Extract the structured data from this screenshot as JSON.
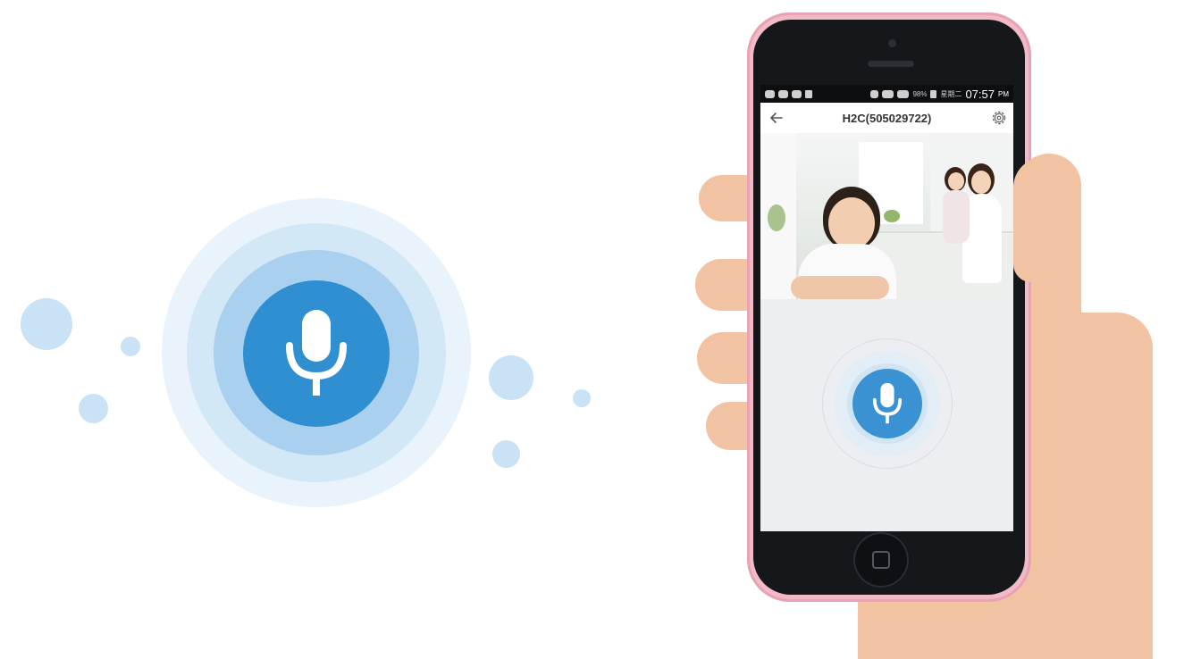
{
  "status_bar": {
    "battery_text": "98%",
    "day_text": "星期二",
    "time": "07:57",
    "ampm": "PM"
  },
  "app_bar": {
    "title": "H2C(505029722)"
  },
  "icons": {
    "back": "arrow-left-icon",
    "settings": "gear-icon",
    "mic": "microphone-icon",
    "home": "home-button-icon"
  },
  "colors": {
    "accent": "#2f8fd1",
    "ring_light": "#e8f3fb",
    "ring_mid": "#d2e8f7",
    "ring_dark": "#a9d1ef",
    "phone_shell": "#f2b9c6",
    "screen_bg": "#eceef1"
  }
}
